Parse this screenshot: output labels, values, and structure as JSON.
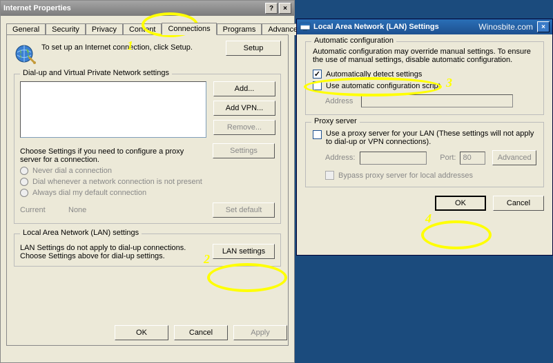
{
  "ip": {
    "title": "Internet Properties",
    "tabs": [
      "General",
      "Security",
      "Privacy",
      "Content",
      "Connections",
      "Programs",
      "Advanced"
    ],
    "setup_text": "To set up an Internet connection, click Setup.",
    "setup_btn": "Setup",
    "dial": {
      "legend": "Dial-up and Virtual Private Network settings",
      "add_btn": "Add...",
      "addvpn_btn": "Add VPN...",
      "remove_btn": "Remove...",
      "settings_btn": "Settings",
      "choose_text": "Choose Settings if you need to configure a proxy server for a connection.",
      "r_never": "Never dial a connection",
      "r_when": "Dial whenever a network connection is not present",
      "r_always": "Always dial my default connection",
      "current_lbl": "Current",
      "current_val": "None",
      "setdefault_btn": "Set default"
    },
    "lan": {
      "legend": "Local Area Network (LAN) settings",
      "desc": "LAN Settings do not apply to dial-up connections. Choose Settings above for dial-up settings.",
      "btn": "LAN settings"
    },
    "ok": "OK",
    "cancel": "Cancel",
    "apply": "Apply"
  },
  "lanwin": {
    "title": "Local Area Network (LAN) Settings",
    "brand": "Winosbite.com",
    "auto": {
      "legend": "Automatic configuration",
      "desc": "Automatic configuration may override manual settings.  To ensure the use of manual settings, disable automatic configuration.",
      "auto_detect": "Automatically detect settings",
      "use_script": "Use automatic configuration script",
      "address_lbl": "Address"
    },
    "proxy": {
      "legend": "Proxy server",
      "desc": "Use a proxy server for your LAN (These settings will not apply to dial-up or VPN connections).",
      "address_lbl": "Address:",
      "port_lbl": "Port:",
      "port_val": "80",
      "advanced_btn": "Advanced",
      "bypass": "Bypass proxy server for local addresses"
    },
    "ok": "OK",
    "cancel": "Cancel"
  },
  "annotations": {
    "n1": "1",
    "n2": "2",
    "n3": "3",
    "n4": "4"
  }
}
